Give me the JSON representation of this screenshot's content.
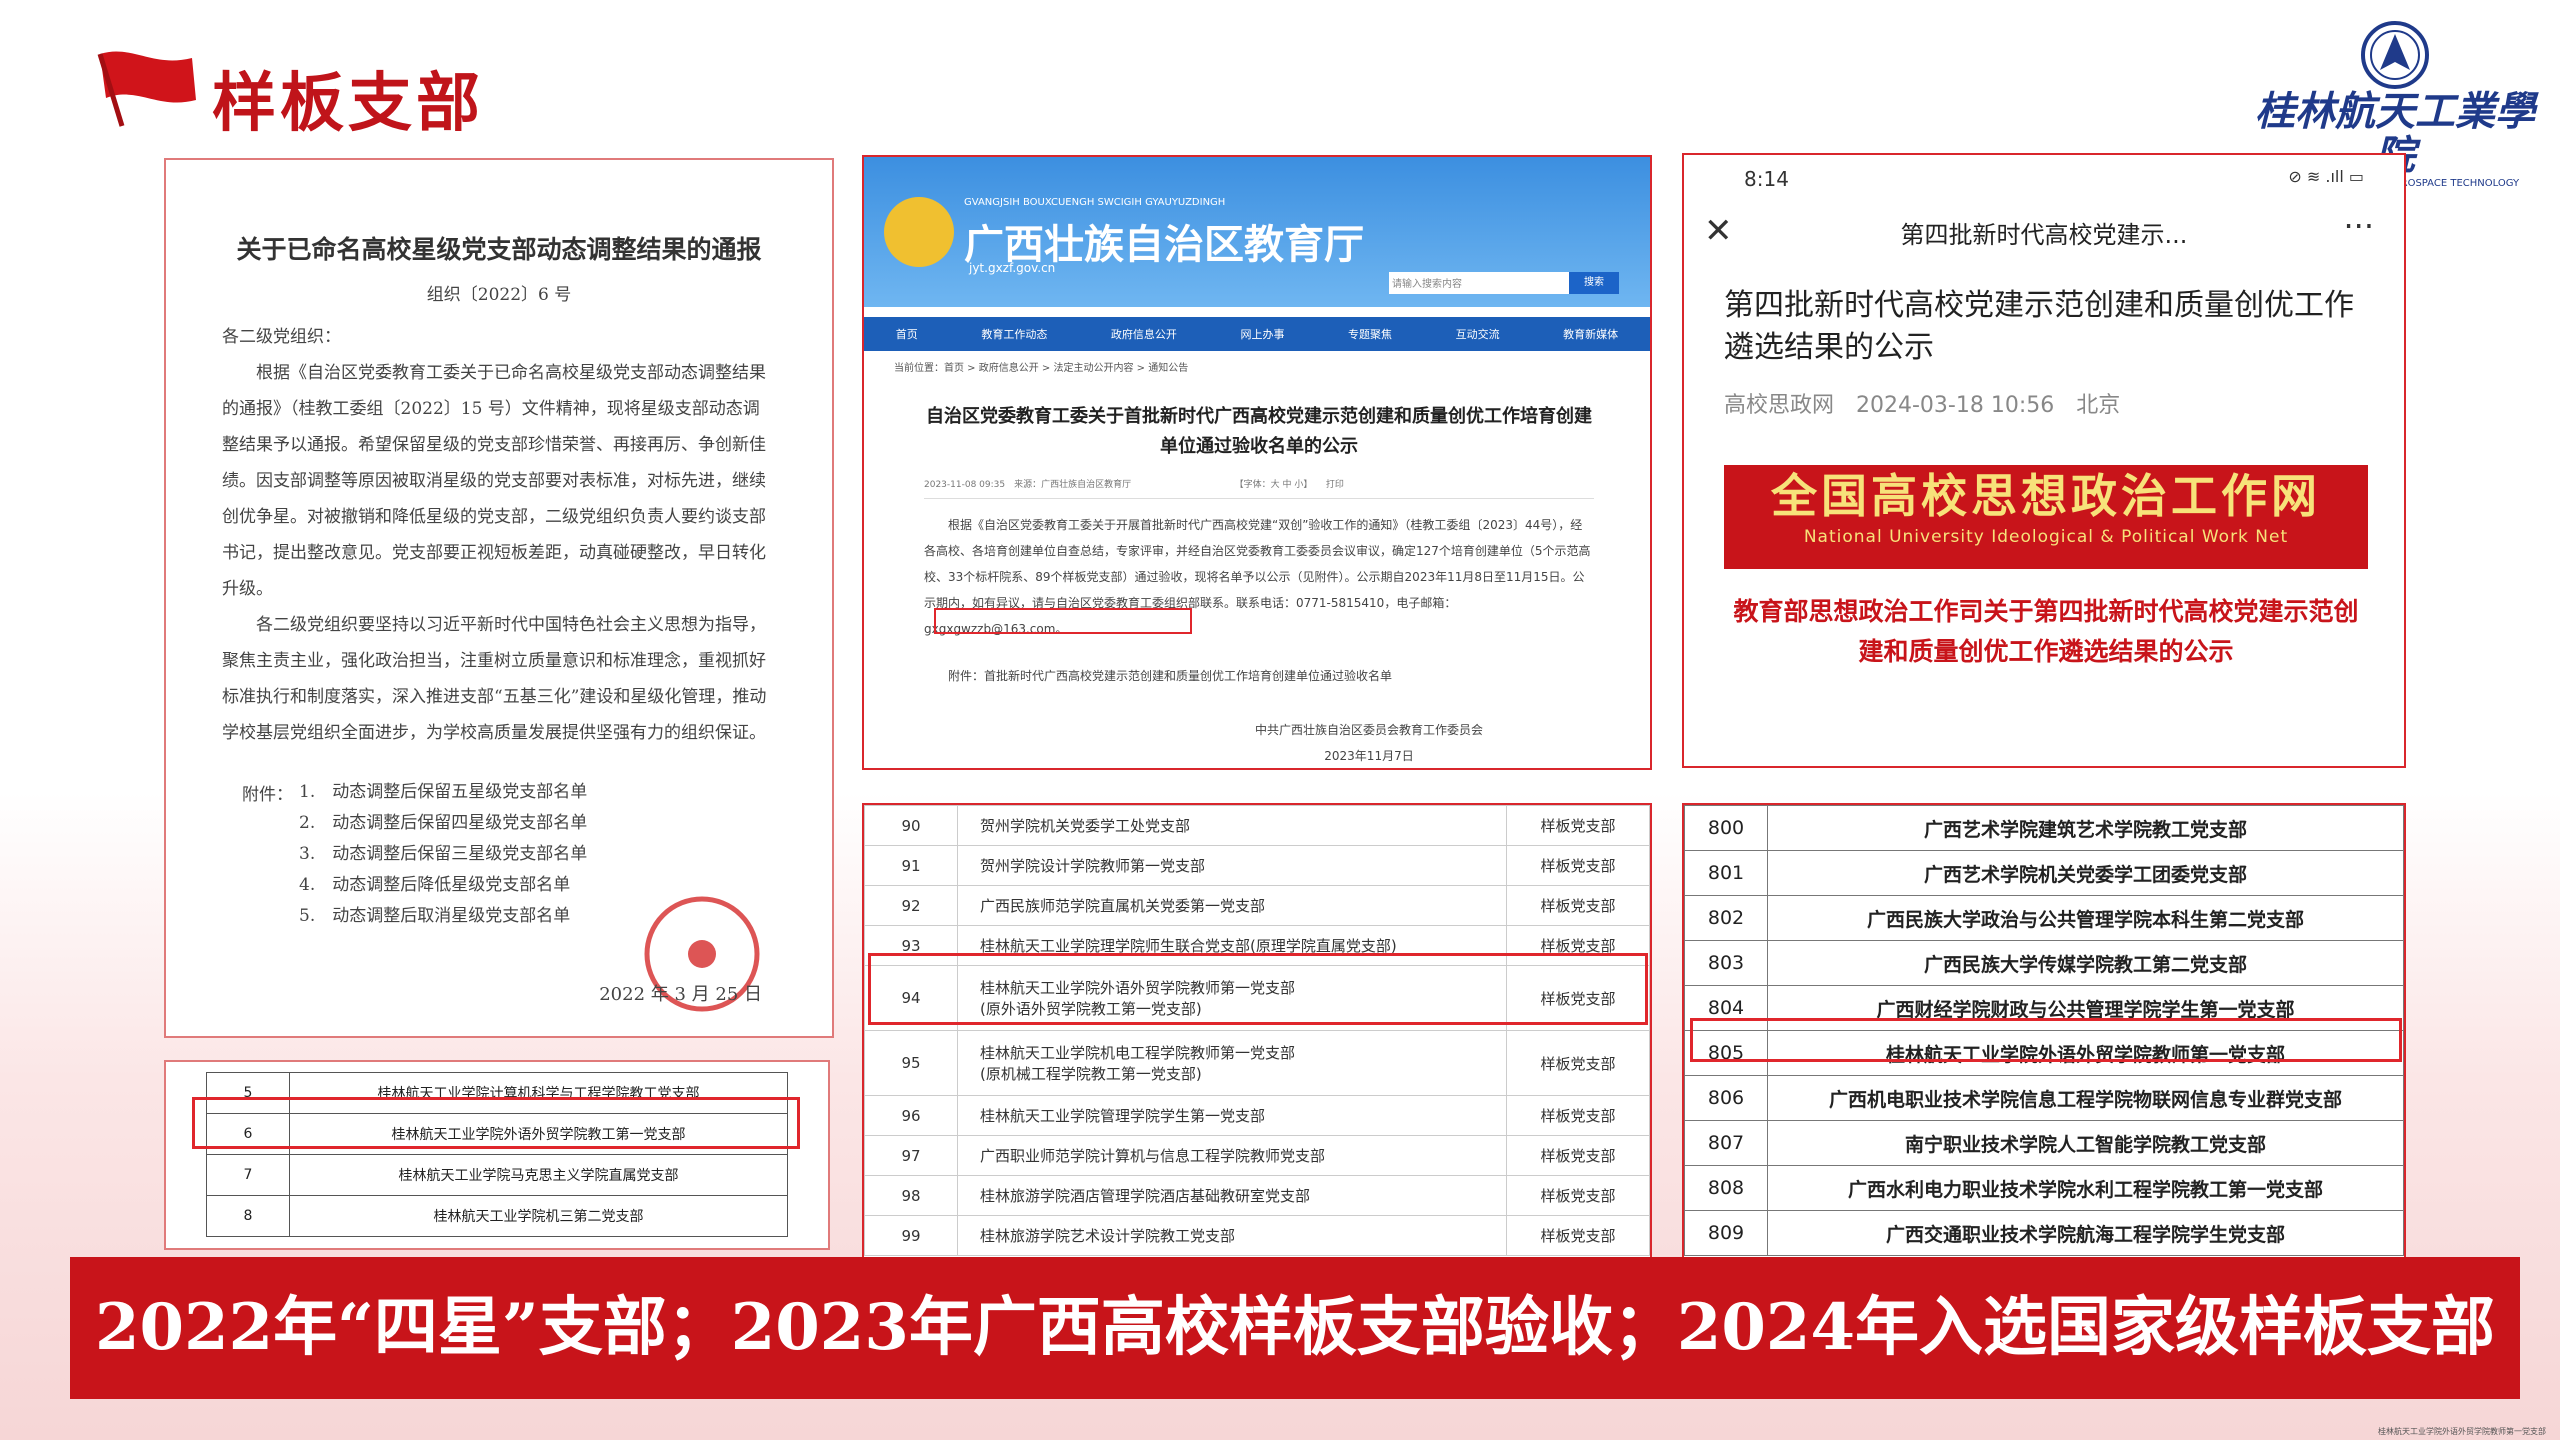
{
  "page": {
    "title": "样板支部",
    "banner": "2022年“四星”支部；2023年广西高校样板支部验收；2024年入选国家级样板支部",
    "footnote": "桂林航天工业学院外语外贸学院教师第一党支部"
  },
  "logo": {
    "cn": "桂林航天工業學院",
    "en": "GUILIN UNIVERSITY OF AEROSPACE TECHNOLOGY"
  },
  "notice": {
    "title": "关于已命名高校星级党支部动态调整结果的通报",
    "number": "组织〔2022〕6 号",
    "salutation": "各二级党组织：",
    "para1": "根据《自治区党委教育工委关于已命名高校星级党支部动态调整结果的通报》（桂教工委组〔2022〕15 号）文件精神，现将星级支部动态调整结果予以通报。希望保留星级的党支部珍惜荣誉、再接再厉、争创新佳绩。因支部调整等原因被取消星级的党支部要对表标准，对标先进，继续创优争星。对被撤销和降低星级的党支部，二级党组织负责人要约谈支部书记，提出整改意见。党支部要正视短板差距，动真碰硬整改，早日转化升级。",
    "para2": "各二级党组织要坚持以习近平新时代中国特色社会主义思想为指导，聚焦主责主业，强化政治担当，注重树立质量意识和标准理念，重视抓好标准执行和制度落实，深入推进支部“五基三化”建设和星级化管理，推动学校基层党组织全面进步，为学校高质量发展提供坚强有力的组织保证。",
    "attachments_label": "附件：",
    "attachments": [
      "1.　动态调整后保留五星级党支部名单",
      "2.　动态调整后保留四星级党支部名单",
      "3.　动态调整后保留三星级党支部名单",
      "4.　动态调整后降低星级党支部名单",
      "5.　动态调整后取消星级党支部名单"
    ],
    "date": "2022 年 3 月 25 日"
  },
  "star_table": {
    "rows": [
      {
        "no": "5",
        "name": "桂林航天工业学院计算机科学与工程学院教工党支部"
      },
      {
        "no": "6",
        "name": "桂林航天工业学院外语外贸学院教工第一党支部"
      },
      {
        "no": "7",
        "name": "桂林航天工业学院马克思主义学院直属党支部"
      },
      {
        "no": "8",
        "name": "桂林航天工业学院机三第二党支部"
      }
    ]
  },
  "gx_site": {
    "pinyin": "GVANGJSIH BOUXCUENGH SWCIGIH GYAUYUZDINGH",
    "name": "广西壮族自治区教育厅",
    "url": "jyt.gxzf.gov.cn",
    "search_placeholder": "请输入搜索内容",
    "search_button": "搜索",
    "nav": [
      "首页",
      "教育工作动态",
      "政府信息公开",
      "网上办事",
      "专题聚焦",
      "互动交流",
      "教育新媒体"
    ],
    "breadcrumb": "当前位置：首页 > 政府信息公开 > 法定主动公开内容 > 通知公告",
    "title": "自治区党委教育工委关于首批新时代广西高校党建示范创建和质量创优工作培育创建单位通过验收名单的公示",
    "meta": "2023-11-08 09:35　来源：广西壮族自治区教育厅　　　　　　　　　　　　【字体：大 中 小】　　打印",
    "body_a": "根据《自治区党委教育工委关于开展首批新时代广西高校党建“双创”验收工作的通知》（桂教工委组〔2023〕44号），经各高校、各培育创建单位自查总结，专家评审，并经自治区党委教育工委委员会议审议，确定127个培育创建单位（5个示范高校、33个标杆院系、89个样板党支部）通过验收，现将名单予以公示（见附件）。",
    "highlight": "公示期自2023年11月8日至11月15日。",
    "body_b": "公示期内，如有异议，请与自治区党委教育工委组织部联系。联系电话：0771-5815410，电子邮箱：gxgxgwzzb@163.com。",
    "attachment": "附件：首批新时代广西高校党建示范创建和质量创优工作培育创建单位通过验收名单",
    "signer": "中共广西壮族自治区委员会教育工作委员会",
    "sign_date": "2023年11月7日"
  },
  "phone": {
    "time": "8:14",
    "status_right": "⊘ ≋ .ıll ▭",
    "header": "第四批新时代高校党建示...",
    "title": "第四批新时代高校党建示范创建和质量创优工作遴选结果的公示",
    "source": "高校思政网　2024-03-18 10:56　北京",
    "banner_cn": "全国高校思想政治工作网",
    "banner_en": "National University Ideological & Political Work Net",
    "heading": "教育部思想政治工作司关于第四批新时代高校党建示范创建和质量创优工作遴选结果的公示"
  },
  "accept_table": {
    "rows": [
      {
        "no": "90",
        "name": "贺州学院机关党委学工处党支部",
        "cat": "样板党支部"
      },
      {
        "no": "91",
        "name": "贺州学院设计学院教师第一党支部",
        "cat": "样板党支部"
      },
      {
        "no": "92",
        "name": "广西民族师范学院直属机关党委第一党支部",
        "cat": "样板党支部"
      },
      {
        "no": "93",
        "name": "桂林航天工业学院理学院师生联合党支部(原理学院直属党支部)",
        "cat": "样板党支部"
      },
      {
        "no": "94",
        "name": "桂林航天工业学院外语外贸学院教师第一党支部",
        "name2": "(原外语外贸学院教工第一党支部)",
        "cat": "样板党支部"
      },
      {
        "no": "95",
        "name": "桂林航天工业学院机电工程学院教师第一党支部",
        "name2": "(原机械工程学院教工第一党支部)",
        "cat": "样板党支部"
      },
      {
        "no": "96",
        "name": "桂林航天工业学院管理学院学生第一党支部",
        "cat": "样板党支部"
      },
      {
        "no": "97",
        "name": "广西职业师范学院计算机与信息工程学院教师党支部",
        "cat": "样板党支部"
      },
      {
        "no": "98",
        "name": "桂林旅游学院酒店管理学院酒店基础教研室党支部",
        "cat": "样板党支部"
      },
      {
        "no": "99",
        "name": "桂林旅游学院艺术设计学院教工党支部",
        "cat": "样板党支部"
      }
    ]
  },
  "national_table": {
    "rows": [
      {
        "no": "800",
        "name": "广西艺术学院建筑艺术学院教工党支部"
      },
      {
        "no": "801",
        "name": "广西艺术学院机关党委学工团委党支部"
      },
      {
        "no": "802",
        "name": "广西民族大学政治与公共管理学院本科生第二党支部"
      },
      {
        "no": "803",
        "name": "广西民族大学传媒学院教工第二党支部"
      },
      {
        "no": "804",
        "name": "广西财经学院财政与公共管理学院学生第一党支部"
      },
      {
        "no": "805",
        "name": "桂林航天工业学院外语外贸学院教师第一党支部"
      },
      {
        "no": "806",
        "name": "广西机电职业技术学院信息工程学院物联网信息专业群党支部"
      },
      {
        "no": "807",
        "name": "南宁职业技术学院人工智能学院教工党支部"
      },
      {
        "no": "808",
        "name": "广西水利电力职业技术学院水利工程学院教工第一党支部"
      },
      {
        "no": "809",
        "name": "广西交通职业技术学院航海工程学院学生党支部"
      }
    ]
  },
  "colors": {
    "accent": "#c8141a",
    "highlight": "#e0262c",
    "nav": "#1d5fb8"
  }
}
